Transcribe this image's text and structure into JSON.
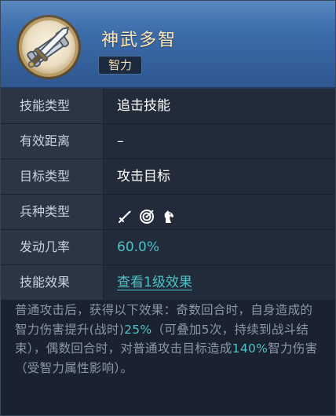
{
  "skill": {
    "name": "神武多智",
    "tag": "智力",
    "icon": "sword-and-scroll-icon"
  },
  "rows": [
    {
      "label": "技能类型",
      "value": "追击技能"
    },
    {
      "label": "有效距离",
      "value": "–"
    },
    {
      "label": "目标类型",
      "value": "攻击目标"
    },
    {
      "label": "兵种类型",
      "icons": [
        "spear-infantry-icon",
        "archer-target-icon",
        "cavalry-horse-icon"
      ]
    },
    {
      "label": "发动几率",
      "value": "60.0%"
    },
    {
      "label": "技能效果",
      "link": "查看1级效果"
    }
  ],
  "description": {
    "p1": "普通攻击后，获得以下效果：奇数回合时，自身造成的智力伤害提升(战时)",
    "h1": "25%",
    "p2": "（可叠加5次，持续到战斗结束），偶数回合时，对普通攻击目标造成",
    "h2": "140%",
    "p3": "智力伤害（受智力属性影响）。"
  },
  "colors": {
    "header": "#3a69a6",
    "name": "#ffe6b0",
    "highlight": "#4cc3c7",
    "label_bg": "#2b3544",
    "value_bg": "#212b39"
  }
}
